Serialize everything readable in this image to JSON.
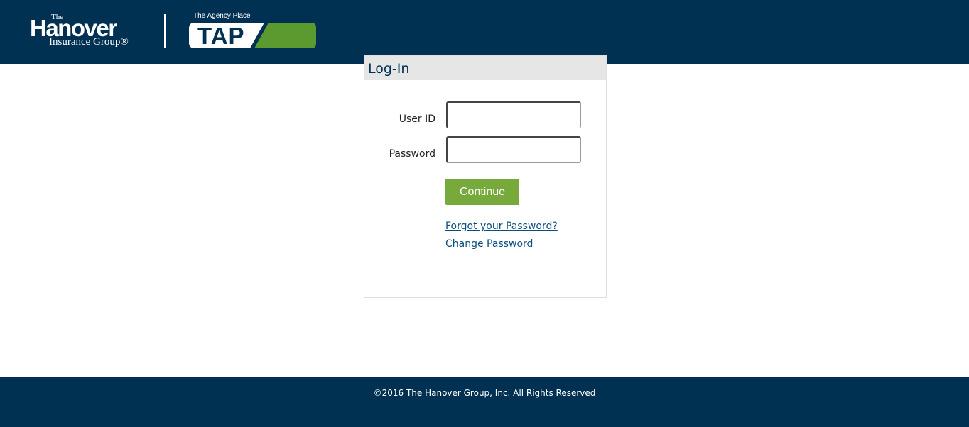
{
  "header": {
    "logo": {
      "the": "The",
      "name": "Hanover",
      "sub": "Insurance Group®"
    },
    "tap_logo": {
      "tagline": "The Agency Place",
      "word": "TAP",
      "color_navy": "#003152",
      "color_green": "#5a9a2e"
    },
    "background_color": "#003152"
  },
  "login": {
    "title": "Log-In",
    "user_id_label": "User ID",
    "user_id_value": "",
    "password_label": "Password",
    "password_value": "",
    "continue_label": "Continue",
    "continue_color": "#78a93b",
    "forgot_password_link": "Forgot your Password?",
    "change_password_link": "Change Password"
  },
  "footer": {
    "copyright": "©2016 The Hanover Group, Inc. All Rights Reserved"
  }
}
